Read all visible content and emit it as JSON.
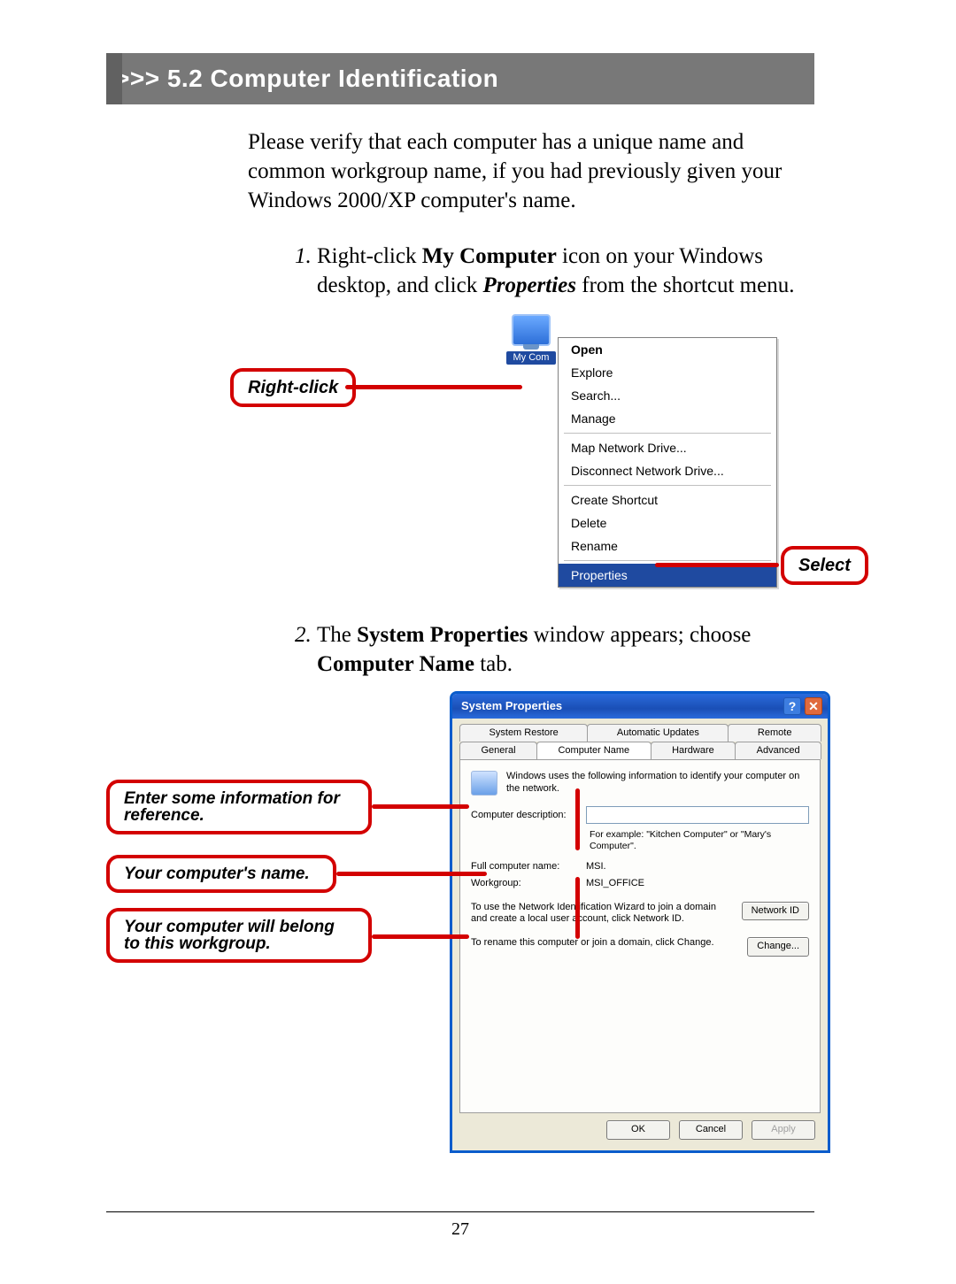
{
  "section": {
    "heading": ">>> 5.2  Computer Identification"
  },
  "intro": "Please verify that each computer has a unique name and common workgroup name, if you had previously given your Windows 2000/XP computer's name.",
  "steps": {
    "s1": {
      "pre": "Right-click ",
      "b1": "My Computer",
      "mid": " icon on your Windows desktop, and click ",
      "b2": "Properties",
      "post": " from the shortcut menu."
    },
    "s2": {
      "pre": "The ",
      "b1": "System Properties",
      "mid": " window appears; choose ",
      "b2": "Computer Name",
      "post": " tab."
    }
  },
  "fig1": {
    "icon_label": "My Com",
    "callout_left": "Right-click",
    "callout_right": "Select",
    "menu": {
      "g1": [
        "Open",
        "Explore",
        "Search...",
        "Manage"
      ],
      "g2": [
        "Map Network Drive...",
        "Disconnect Network Drive..."
      ],
      "g3": [
        "Create Shortcut",
        "Delete",
        "Rename"
      ],
      "g4": [
        "Properties"
      ]
    }
  },
  "fig2": {
    "title": "System Properties",
    "tabs_row1": [
      "System Restore",
      "Automatic Updates",
      "Remote"
    ],
    "tabs_row2": [
      "General",
      "Computer Name",
      "Hardware",
      "Advanced"
    ],
    "info_text": "Windows uses the following information to identify your computer on the network.",
    "desc_label": "Computer description:",
    "desc_value": "",
    "desc_hint": "For example: \"Kitchen Computer\" or \"Mary's Computer\".",
    "fullname_label": "Full computer name:",
    "fullname_value": "MSI.",
    "workgroup_label": "Workgroup:",
    "workgroup_value": "MSI_OFFICE",
    "wizard_text": "To use the Network Identification Wizard to join a domain and create a local user account, click Network ID.",
    "networkid_btn": "Network ID",
    "change_text": "To rename this computer or join a domain, click Change.",
    "change_btn": "Change...",
    "ok": "OK",
    "cancel": "Cancel",
    "apply": "Apply",
    "callouts": {
      "c1": "Enter some information for reference.",
      "c2": "Your computer's name.",
      "c3": "Your computer will belong to this workgroup."
    }
  },
  "page_number": "27"
}
